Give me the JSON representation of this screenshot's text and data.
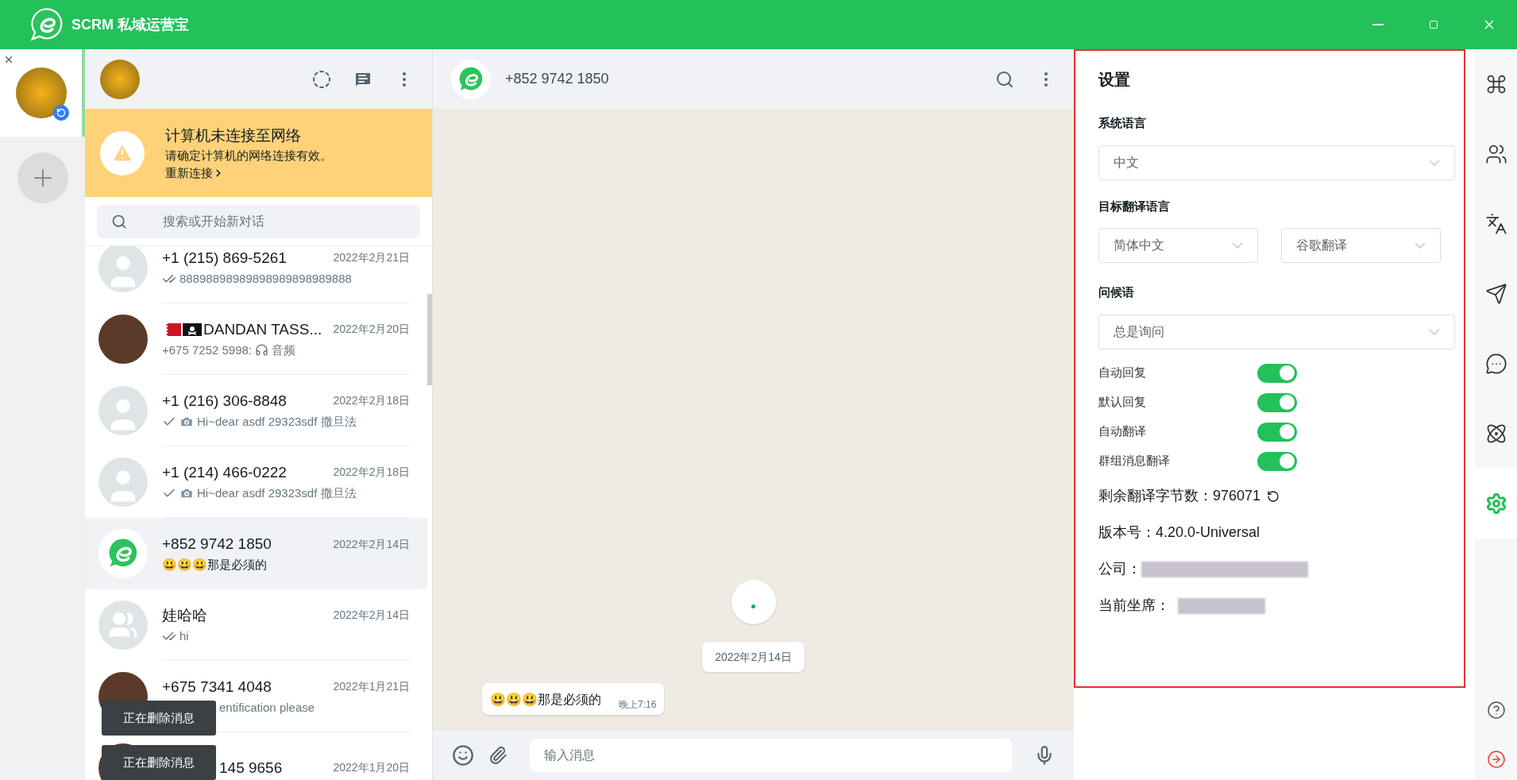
{
  "app": {
    "title": "SCRM 私域运营宝"
  },
  "accounts": [
    {
      "selected": true
    }
  ],
  "chat_list": {
    "banner": {
      "title": "计算机未连接至网络",
      "message": "请确定计算机的网络连接有效。",
      "link": "重新连接"
    },
    "search": {
      "placeholder": "搜索或开始新对话"
    },
    "chats": [
      {
        "name": "+1 (215) 869-5261",
        "date": "2022年2月21日",
        "avatar": {
          "kind": "default"
        },
        "status": {
          "kind": "delivered"
        },
        "preview": "88898898989898989898989888",
        "selected": false
      },
      {
        "name": "DANDAN TASS...",
        "flags": [
          {
            "kind": "bahrain"
          },
          {
            "kind": "pirate"
          }
        ],
        "date": "2022年2月20日",
        "avatar": {
          "kind": "photo"
        },
        "prefix": "+675 7252 5998:",
        "media": {
          "kind": "audio"
        },
        "preview": "音频",
        "selected": false
      },
      {
        "name": "+1 (216) 306-8848",
        "date": "2022年2月18日",
        "avatar": {
          "kind": "default"
        },
        "status": {
          "kind": "sent"
        },
        "media": {
          "kind": "photo"
        },
        "preview": "Hi~dear asdf 29323sdf 撒旦法",
        "selected": false
      },
      {
        "name": "+1 (214) 466-0222",
        "date": "2022年2月18日",
        "avatar": {
          "kind": "default"
        },
        "status": {
          "kind": "sent"
        },
        "media": {
          "kind": "photo"
        },
        "preview": "Hi~dear asdf 29323sdf 撒旦法",
        "selected": false
      },
      {
        "name": "+852 9742 1850",
        "date": "2022年2月14日",
        "avatar": {
          "kind": "logo"
        },
        "preview": "😃😃😃那是必须的",
        "selected": true
      },
      {
        "name": "娃哈哈",
        "date": "2022年2月14日",
        "avatar": {
          "kind": "group"
        },
        "status": {
          "kind": "delivered"
        },
        "preview": "hi",
        "selected": false
      },
      {
        "name": "+675 7341 4048",
        "date": "2022年1月21日",
        "avatar": {
          "kind": "photo"
        },
        "preview": "entification please",
        "selected": false
      },
      {
        "name": "145 9656",
        "date": "2022年1月20日",
        "avatar": {
          "kind": "photo"
        },
        "selected": false
      }
    ],
    "toasts": [
      "正在删除消息",
      "正在删除消息"
    ]
  },
  "chat": {
    "name": "+852 9742 1850",
    "date_chip": "2022年2月14日",
    "messages": [
      {
        "text": "😃😃😃那是必须的",
        "time": "晚上7:16"
      }
    ],
    "composer": {
      "placeholder": "输入消息"
    }
  },
  "settings": {
    "title": "设置",
    "system_language": {
      "label": "系统语言",
      "value": "中文"
    },
    "target_language": {
      "label": "目标翻译语言",
      "language": "简体中文",
      "engine": "谷歌翻译"
    },
    "greeting": {
      "label": "问候语",
      "value": "总是询问"
    },
    "toggles": [
      {
        "label": "自动回复",
        "on": true
      },
      {
        "label": "默认回复",
        "on": true
      },
      {
        "label": "自动翻译",
        "on": true
      },
      {
        "label": "群组消息翻译",
        "on": true
      }
    ],
    "info": [
      {
        "label": "剩余翻译字节数：",
        "value": "976071",
        "kind": "refresh"
      },
      {
        "label": "版本号：",
        "value": "4.20.0-Universal",
        "kind": "text"
      },
      {
        "label": "公司：",
        "kind": "redacted"
      },
      {
        "label": "当前坐席：",
        "kind": "redacted"
      }
    ]
  },
  "nav": [
    {
      "kind": "command",
      "selected": false
    },
    {
      "kind": "people",
      "selected": false
    },
    {
      "kind": "translate",
      "selected": false
    },
    {
      "kind": "send",
      "selected": false
    },
    {
      "kind": "chat",
      "selected": false
    },
    {
      "kind": "atom",
      "selected": false
    },
    {
      "kind": "gear",
      "selected": true
    }
  ],
  "nav_bottom": [
    {
      "kind": "help"
    },
    {
      "kind": "logout"
    }
  ]
}
